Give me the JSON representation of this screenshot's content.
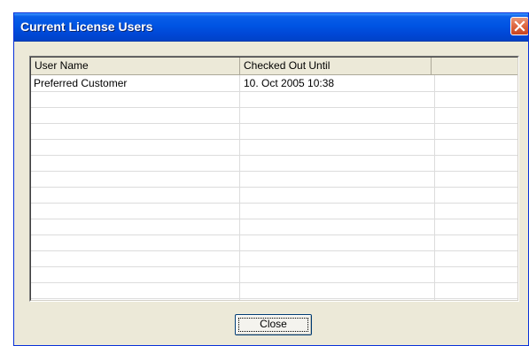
{
  "window": {
    "title": "Current License Users"
  },
  "columns": [
    {
      "label": "User Name"
    },
    {
      "label": "Checked Out Until"
    },
    {
      "label": ""
    }
  ],
  "rows": [
    {
      "user_name": "Preferred Customer",
      "checked_out_until": "10. Oct 2005 10:38"
    }
  ],
  "buttons": {
    "close": "Close"
  }
}
